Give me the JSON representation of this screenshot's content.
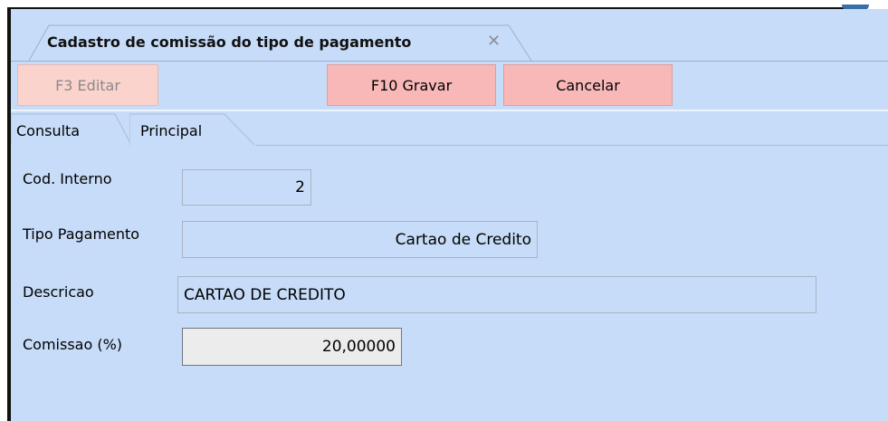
{
  "document_tab": {
    "title": "Cadastro de comissão do tipo de pagamento",
    "close_icon": "close-icon"
  },
  "toolbar": {
    "edit_label": "F3 Editar",
    "save_label": "F10 Gravar",
    "cancel_label": "Cancelar"
  },
  "tabs": [
    {
      "label": "Consulta"
    },
    {
      "label": "Principal"
    }
  ],
  "form": {
    "cod_interno": {
      "label": "Cod. Interno",
      "value": "2"
    },
    "tipo_pagamento": {
      "label": "Tipo  Pagamento",
      "value": "Cartao de Credito"
    },
    "descricao": {
      "label": "Descricao",
      "value": "CARTAO DE CREDITO"
    },
    "comissao": {
      "label": "Comissao (%)",
      "value": "20,00000"
    }
  },
  "colors": {
    "window_bg": "#c7dcf8",
    "button_bg": "#f9b8b8",
    "button_disabled_bg": "#fbd3cd"
  }
}
